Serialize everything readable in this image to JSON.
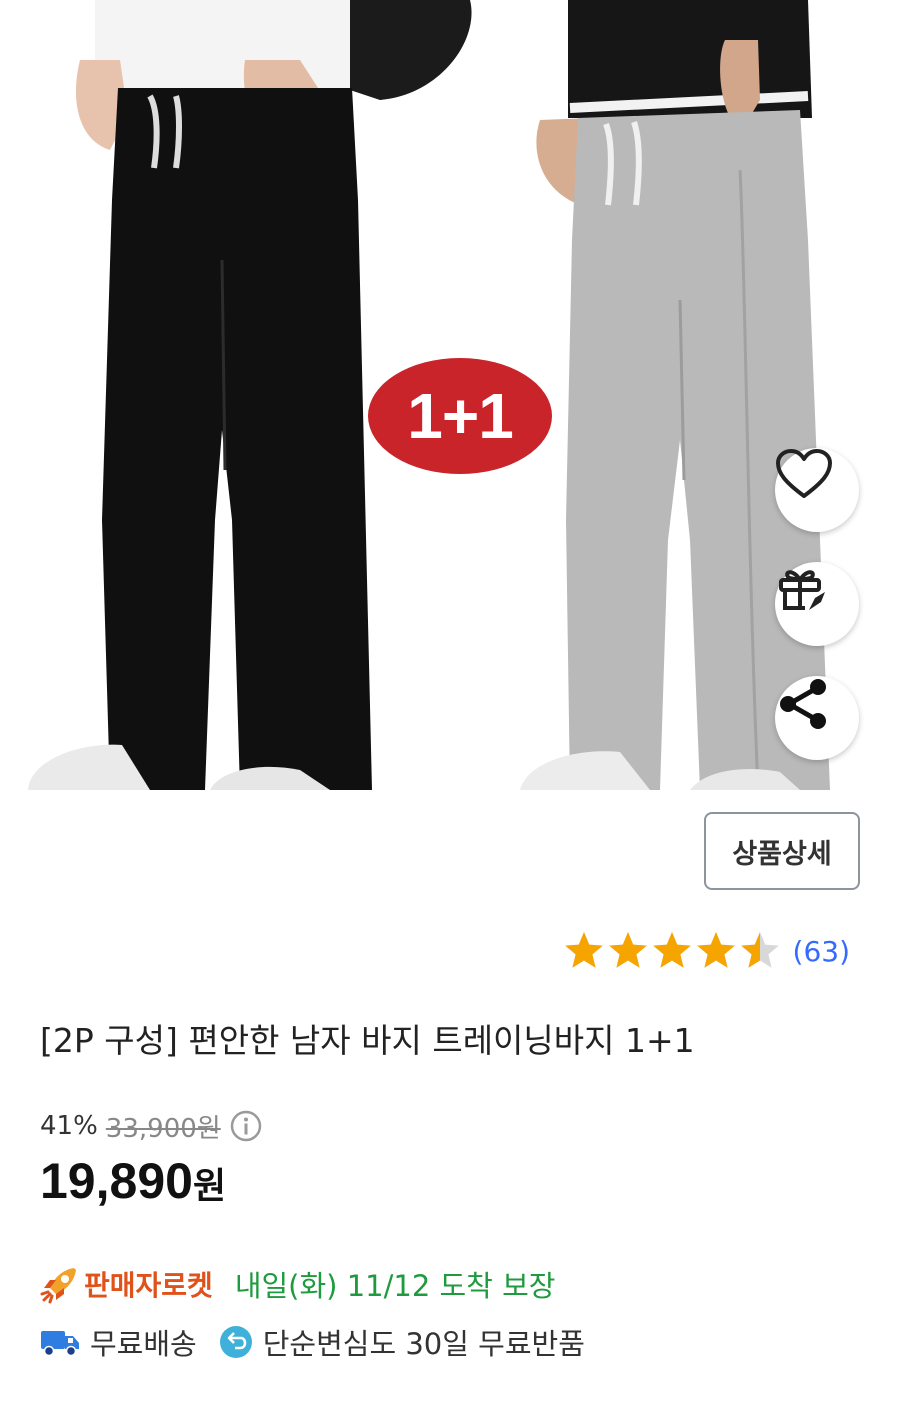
{
  "product_image": {
    "promo_badge": "1+1"
  },
  "actions": {
    "wishlist_icon": "heart-icon",
    "gift_icon": "gift-icon",
    "share_icon": "share-icon"
  },
  "detail_button": {
    "label": "상품상세"
  },
  "rating": {
    "score": 4.5,
    "max": 5,
    "review_count": "(63)",
    "star_color": "#f5a400"
  },
  "product": {
    "title": "[2P 구성] 편안한 남자 바지 트레이닝바지 1+1"
  },
  "price": {
    "discount": "41%",
    "original": "33,900원",
    "sale_number": "19,890",
    "sale_unit": "원"
  },
  "delivery": {
    "rocket_label": "판매자로켓",
    "arrival": "내일(화) 11/12 도착 보장",
    "rocket_color": "#e0521b",
    "arrival_color": "#1f9b3f"
  },
  "perks": {
    "free_shipping": "무료배송",
    "free_return": "단순변심도 30일 무료반품"
  }
}
